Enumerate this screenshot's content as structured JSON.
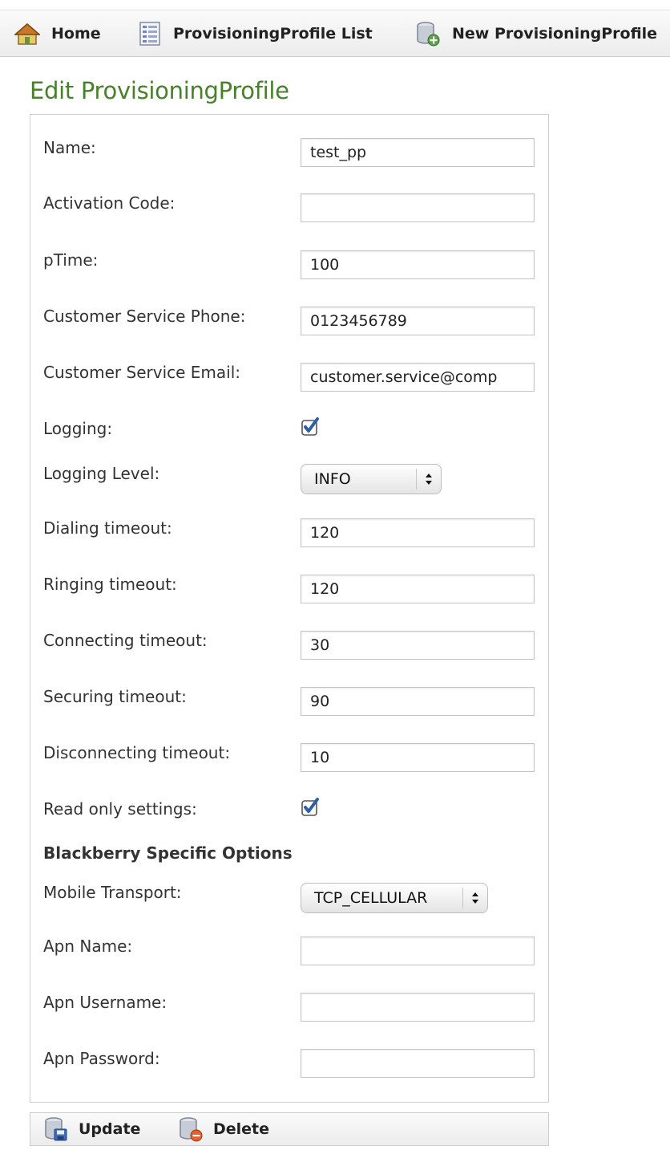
{
  "nav": {
    "home": "Home",
    "list": "ProvisioningProfile List",
    "create": "New ProvisioningProfile"
  },
  "page_title": "Edit ProvisioningProfile",
  "form": {
    "name": {
      "label": "Name:",
      "value": "test_pp"
    },
    "activation_code": {
      "label": "Activation Code:",
      "value": ""
    },
    "ptime": {
      "label": "pTime:",
      "value": "100"
    },
    "cs_phone": {
      "label": "Customer Service Phone:",
      "value": "0123456789"
    },
    "cs_email": {
      "label": "Customer Service Email:",
      "value": "customer.service@comp"
    },
    "logging": {
      "label": "Logging:",
      "checked": true
    },
    "logging_level": {
      "label": "Logging Level:",
      "selected": "INFO"
    },
    "dialing_timeout": {
      "label": "Dialing timeout:",
      "value": "120"
    },
    "ringing_timeout": {
      "label": "Ringing timeout:",
      "value": "120"
    },
    "connecting_timeout": {
      "label": "Connecting timeout:",
      "value": "30"
    },
    "securing_timeout": {
      "label": "Securing timeout:",
      "value": "90"
    },
    "disconnecting_timeout": {
      "label": "Disconnecting timeout:",
      "value": "10"
    },
    "read_only": {
      "label": "Read only settings:",
      "checked": true
    },
    "blackberry_heading": "Blackberry Specific Options",
    "mobile_transport": {
      "label": "Mobile Transport:",
      "selected": "TCP_CELLULAR"
    },
    "apn_name": {
      "label": "Apn Name:",
      "value": ""
    },
    "apn_username": {
      "label": "Apn Username:",
      "value": ""
    },
    "apn_password": {
      "label": "Apn Password:",
      "value": ""
    }
  },
  "buttons": {
    "update": "Update",
    "delete": "Delete"
  },
  "colors": {
    "title_green": "#48802c",
    "checkbox_blue": "#2f5ea8"
  }
}
